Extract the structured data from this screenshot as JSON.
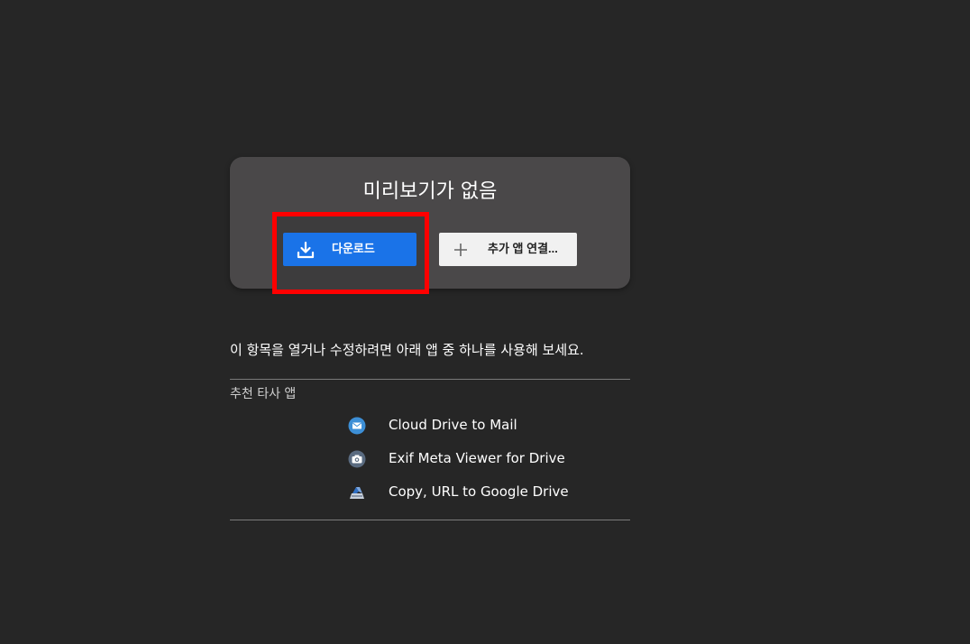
{
  "preview": {
    "title": "미리보기가 없음",
    "download_label": "다운로드",
    "connect_label": "추가 앱 연결..."
  },
  "hint": "이 항목을 열거나 수정하려면 아래 앱 중 하나를 사용해 보세요.",
  "recommended": {
    "title": "추천 타사 앱",
    "apps": [
      {
        "name": "Cloud Drive to Mail",
        "icon": "mail-icon"
      },
      {
        "name": "Exif Meta Viewer for Drive",
        "icon": "camera-icon"
      },
      {
        "name": "Copy, URL to Google Drive",
        "icon": "drive-copy-icon"
      }
    ]
  },
  "colors": {
    "background": "#262626",
    "card": "#4a4849",
    "primary": "#1a73e8",
    "highlight": "#ff0000"
  }
}
